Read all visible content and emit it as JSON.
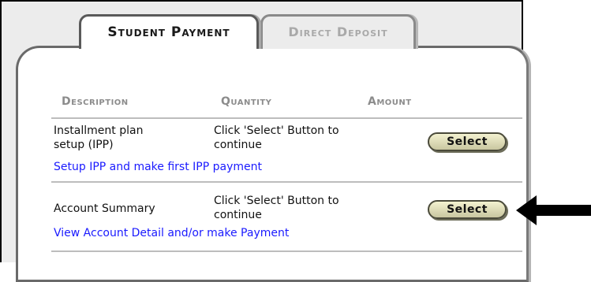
{
  "tabs": [
    {
      "label": "Student Payment",
      "active": true
    },
    {
      "label": "Direct Deposit",
      "active": false
    }
  ],
  "table": {
    "headers": {
      "description": "Description",
      "quantity": "Quantity",
      "amount": "Amount"
    },
    "rows": [
      {
        "description_line1": "Installment plan",
        "description_line2": "setup (IPP)",
        "quantity_line1": "Click 'Select' Button to",
        "quantity_line2": "continue",
        "button_label": "Select",
        "link_text": "Setup IPP and make first IPP payment"
      },
      {
        "description_line1": "Account Summary",
        "quantity_line1": "Click 'Select' Button to",
        "quantity_line2": "continue",
        "button_label": "Select",
        "link_text": "View Account Detail and/or make Payment"
      }
    ]
  },
  "annotation": {
    "icon": "arrow-left-icon",
    "color": "#000000"
  },
  "colors": {
    "link": "#1a1aff",
    "button_fill": "#e6e4bd",
    "header_text": "#8c8c8c"
  }
}
